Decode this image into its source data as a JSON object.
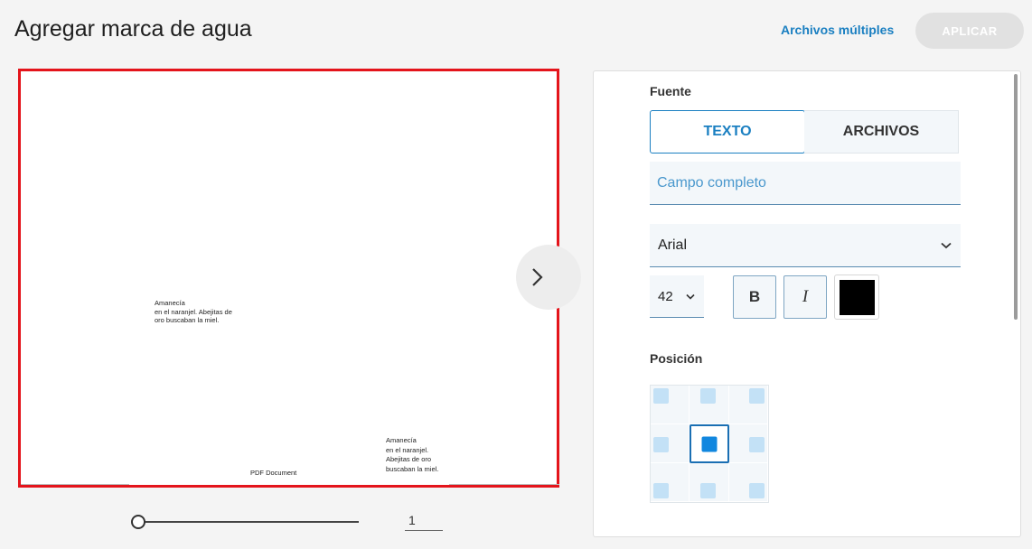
{
  "header": {
    "title": "Agregar marca de agua",
    "multi_files_link": "Archivos múltiples",
    "apply_button": "APLICAR"
  },
  "preview": {
    "watermark_left": "Amanecía\nen el naranjel. Abejitas de\noro buscaban la miel.",
    "watermark_right": "Amanecía\nen el naranjel.\nAbejitas de oro\nbuscaban la miel.",
    "footer_text": "PDF Document",
    "next_icon": "chevron-right-icon"
  },
  "pager": {
    "current_page": "1"
  },
  "panel": {
    "source_label": "Fuente",
    "tabs": [
      {
        "label": "TEXTO",
        "active": true
      },
      {
        "label": "ARCHIVOS",
        "active": false
      }
    ],
    "text_input": {
      "value": "",
      "placeholder": "Campo completo"
    },
    "font": {
      "selected": "Arial"
    },
    "font_size": {
      "selected": "42"
    },
    "style_buttons": {
      "bold": "B",
      "italic": "I"
    },
    "color": "#000000",
    "position_label": "Posición",
    "position_selected": "center"
  },
  "colors": {
    "accent": "#1a7fc1",
    "preview_border": "#e4141b",
    "position_active": "#1187df"
  }
}
